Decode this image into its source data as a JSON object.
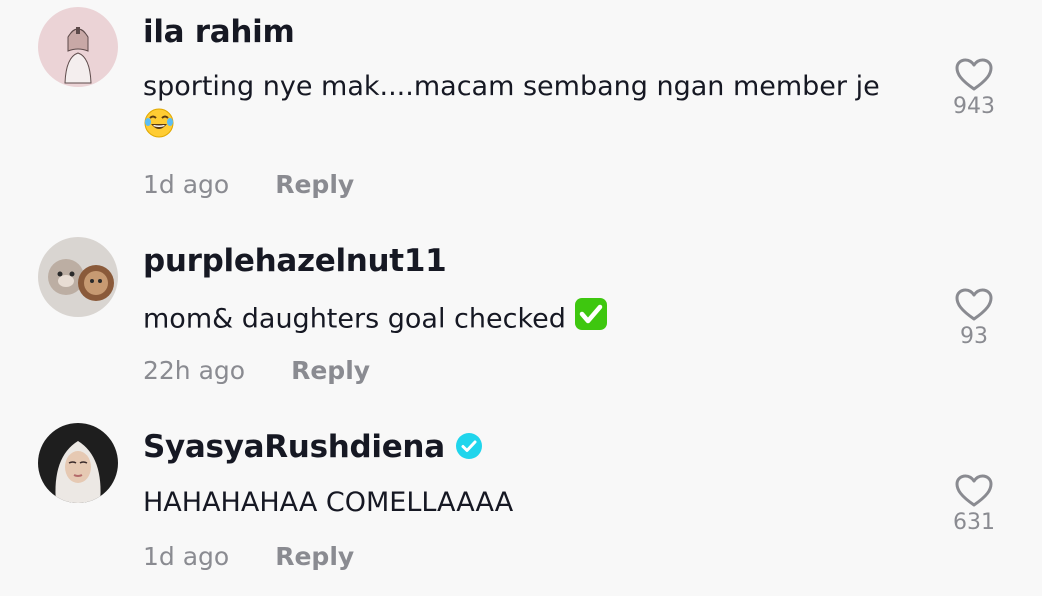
{
  "comments": [
    {
      "username": "ila rahim",
      "text": "sporting nye mak....macam sembang ngan member je",
      "emoji": "face-with-tears-of-joy-emoji",
      "time": "1d ago",
      "reply_label": "Reply",
      "likes": "943",
      "verified": false
    },
    {
      "username": "purplehazelnut11",
      "text": "mom& daughters goal checked",
      "emoji": "check-mark-button-emoji",
      "time": "22h ago",
      "reply_label": "Reply",
      "likes": "93",
      "verified": false
    },
    {
      "username": "SyasyaRushdiena",
      "text": "HAHAHAHAA COMELLAAAA",
      "emoji": "",
      "time": "1d ago",
      "reply_label": "Reply",
      "likes": "631",
      "verified": true
    }
  ],
  "colors": {
    "background": "#f8f8f8",
    "text": "#161823",
    "secondary": "#8a8b91",
    "verified": "#20d5ec",
    "check_emoji": "#3ec70f"
  },
  "icons": {
    "like": "heart-outline-icon",
    "verified": "verified-badge-icon"
  }
}
